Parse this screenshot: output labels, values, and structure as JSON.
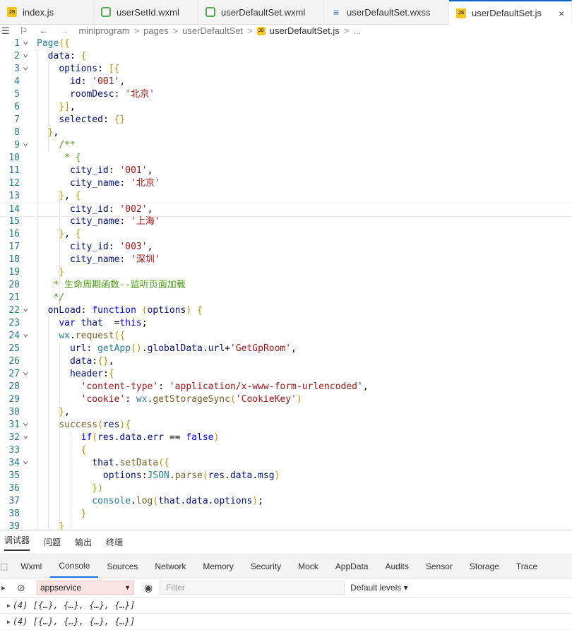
{
  "tabs": [
    {
      "label": "index.js",
      "icon": "js-file-icon",
      "active": false
    },
    {
      "label": "userSetId.wxml",
      "icon": "wxml-file-icon",
      "active": false
    },
    {
      "label": "userDefaultSet.wxml",
      "icon": "wxml-file-icon",
      "active": false
    },
    {
      "label": "userDefaultSet.wxss",
      "icon": "wxss-file-icon",
      "active": false
    },
    {
      "label": "userDefaultSet.js",
      "icon": "js-file-icon",
      "active": true,
      "close": "×"
    }
  ],
  "breadcrumb": {
    "items": [
      "miniprogram",
      "pages",
      "userDefaultSet",
      "userDefaultSet.js",
      "..."
    ],
    "sep": ">"
  },
  "editor": {
    "lines": [
      {
        "n": "1",
        "fold": true,
        "code": "Page({"
      },
      {
        "n": "2",
        "fold": true,
        "code": "  data: {"
      },
      {
        "n": "3",
        "fold": true,
        "code": "    options: [{"
      },
      {
        "n": "4",
        "fold": false,
        "code": "      id: '001',"
      },
      {
        "n": "5",
        "fold": false,
        "code": "      roomDesc: '北京'"
      },
      {
        "n": "6",
        "fold": false,
        "code": "    }],"
      },
      {
        "n": "7",
        "fold": false,
        "code": "    selected: {}"
      },
      {
        "n": "8",
        "fold": false,
        "code": "  },"
      },
      {
        "n": "9",
        "fold": true,
        "code": "    /**"
      },
      {
        "n": "10",
        "fold": false,
        "code": "     * {"
      },
      {
        "n": "11",
        "fold": false,
        "code": "      city_id: '001',"
      },
      {
        "n": "12",
        "fold": false,
        "code": "      city_name: '北京'"
      },
      {
        "n": "13",
        "fold": false,
        "code": "    }, {"
      },
      {
        "n": "14",
        "fold": false,
        "code": "      city_id: '002',"
      },
      {
        "n": "15",
        "fold": false,
        "code": "      city_name: '上海'"
      },
      {
        "n": "16",
        "fold": false,
        "code": "    }, {"
      },
      {
        "n": "17",
        "fold": false,
        "code": "      city_id: '003',"
      },
      {
        "n": "18",
        "fold": false,
        "code": "      city_name: '深圳'"
      },
      {
        "n": "19",
        "fold": false,
        "code": "    }"
      },
      {
        "n": "20",
        "fold": false,
        "code": "   * 生命周期函数--监听页面加载"
      },
      {
        "n": "21",
        "fold": false,
        "code": "   */"
      },
      {
        "n": "22",
        "fold": true,
        "code": "  onLoad: function (options) {"
      },
      {
        "n": "23",
        "fold": false,
        "code": "    var that  =this;"
      },
      {
        "n": "24",
        "fold": true,
        "code": "    wx.request({"
      },
      {
        "n": "25",
        "fold": false,
        "code": "      url: getApp().globalData.url+'GetGpRoom',"
      },
      {
        "n": "26",
        "fold": false,
        "code": "      data:{},"
      },
      {
        "n": "27",
        "fold": true,
        "code": "      header:{"
      },
      {
        "n": "28",
        "fold": false,
        "code": "        'content-type': 'application/x-www-form-urlencoded',"
      },
      {
        "n": "29",
        "fold": false,
        "code": "        'cookie': wx.getStorageSync('CookieKey')"
      },
      {
        "n": "30",
        "fold": false,
        "code": "    },"
      },
      {
        "n": "31",
        "fold": true,
        "code": "    success(res){"
      },
      {
        "n": "32",
        "fold": true,
        "code": "        if(res.data.err == false)"
      },
      {
        "n": "33",
        "fold": false,
        "code": "        {"
      },
      {
        "n": "34",
        "fold": true,
        "code": "          that.setData({"
      },
      {
        "n": "35",
        "fold": false,
        "code": "            options:JSON.parse(res.data.msg)"
      },
      {
        "n": "36",
        "fold": false,
        "code": "          })"
      },
      {
        "n": "37",
        "fold": false,
        "code": "          console.log(that.data.options);"
      },
      {
        "n": "38",
        "fold": false,
        "code": "        }"
      },
      {
        "n": "39",
        "fold": false,
        "code": "    }"
      }
    ]
  },
  "devtools": {
    "top_tabs": [
      "调试器",
      "问题",
      "输出",
      "终端"
    ],
    "panel_tabs": [
      "Wxml",
      "Console",
      "Sources",
      "Network",
      "Memory",
      "Security",
      "Mock",
      "AppData",
      "Audits",
      "Sensor",
      "Storage",
      "Trace"
    ],
    "active_panel": "Console",
    "context": "appservice",
    "filter_placeholder": "Filter",
    "levels": "Default levels ▾",
    "logs": [
      "(4) [{…}, {…}, {…}, {…}]",
      "(4) [{…}, {…}, {…}, {…}]"
    ]
  },
  "colors": {
    "accent": "#0066cc",
    "context_bg": "#fbe3e3"
  }
}
